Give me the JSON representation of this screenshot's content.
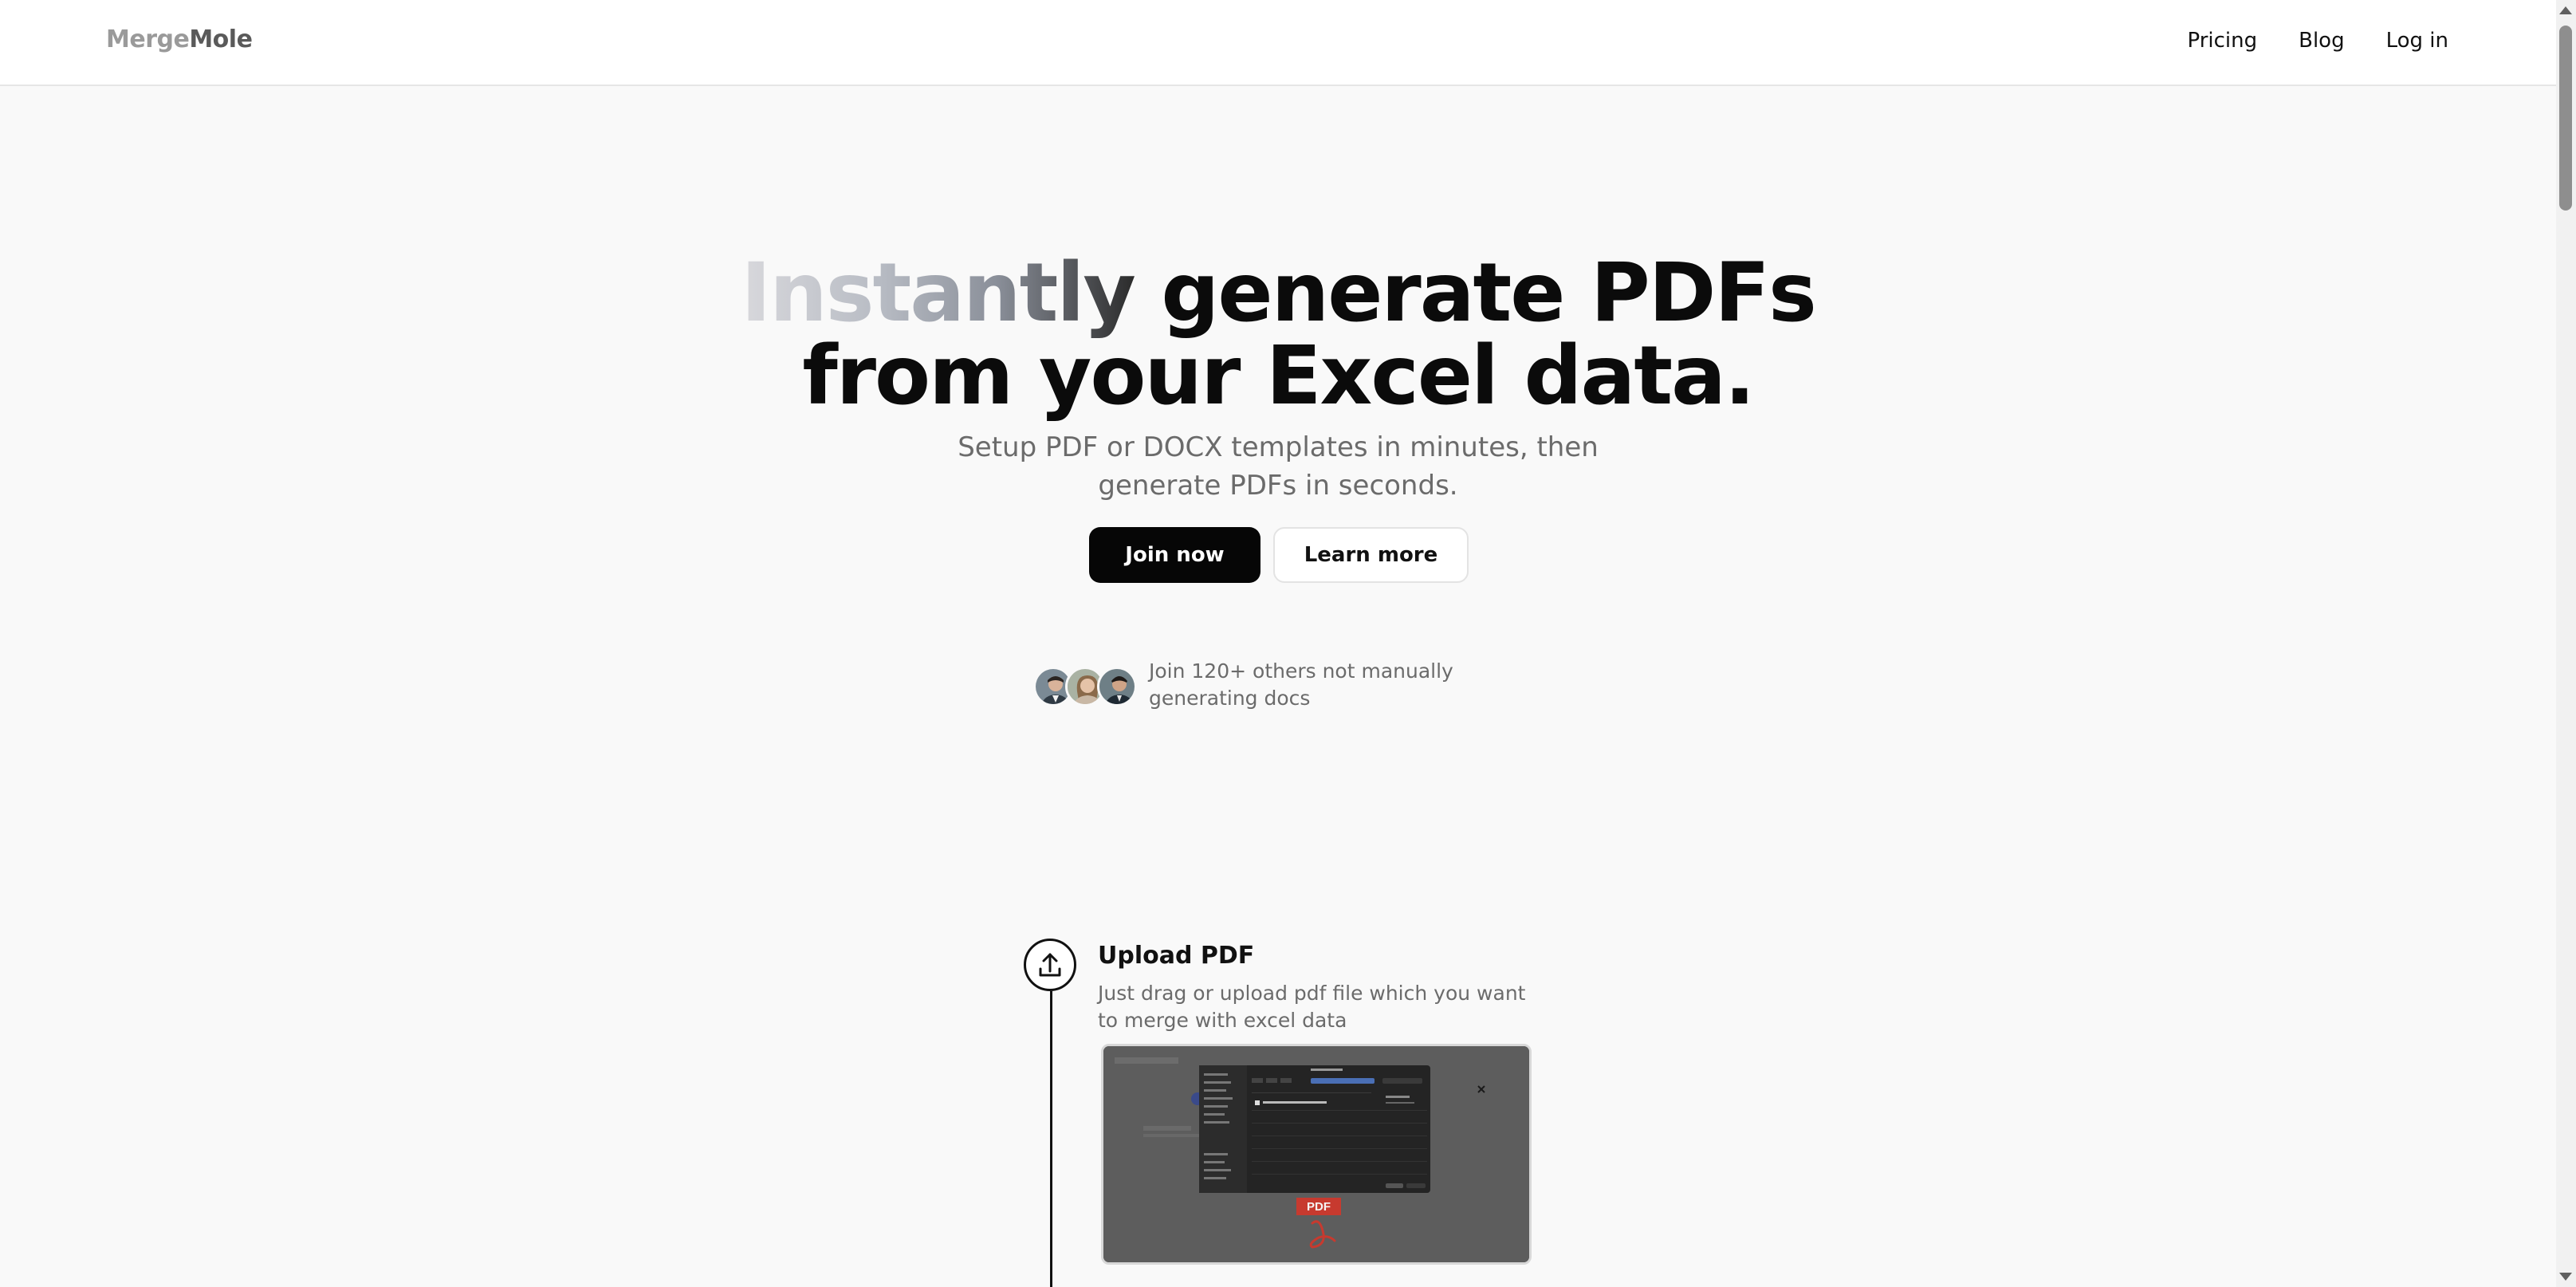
{
  "header": {
    "logo_part1": "Merge",
    "logo_part2": "Mole",
    "nav": {
      "pricing": "Pricing",
      "blog": "Blog",
      "login": "Log in"
    }
  },
  "hero": {
    "title_faded": "Instantly",
    "title_line1_rest": " generate PDFs",
    "title_line2": "from your Excel data.",
    "subtitle": "Setup PDF or DOCX templates in minutes, then generate PDFs in seconds.",
    "join_button": "Join now",
    "learn_button": "Learn more",
    "social_proof": "Join 120+ others not manually generating docs"
  },
  "steps": [
    {
      "icon": "upload-icon",
      "title": "Upload PDF",
      "description": "Just drag or upload pdf file which you want to merge with excel data",
      "preview_badge": "PDF"
    }
  ],
  "colors": {
    "primary": "#060606",
    "background": "#f9f9f9",
    "muted_text": "#6b6b6b",
    "pdf_red": "#d9352b"
  }
}
